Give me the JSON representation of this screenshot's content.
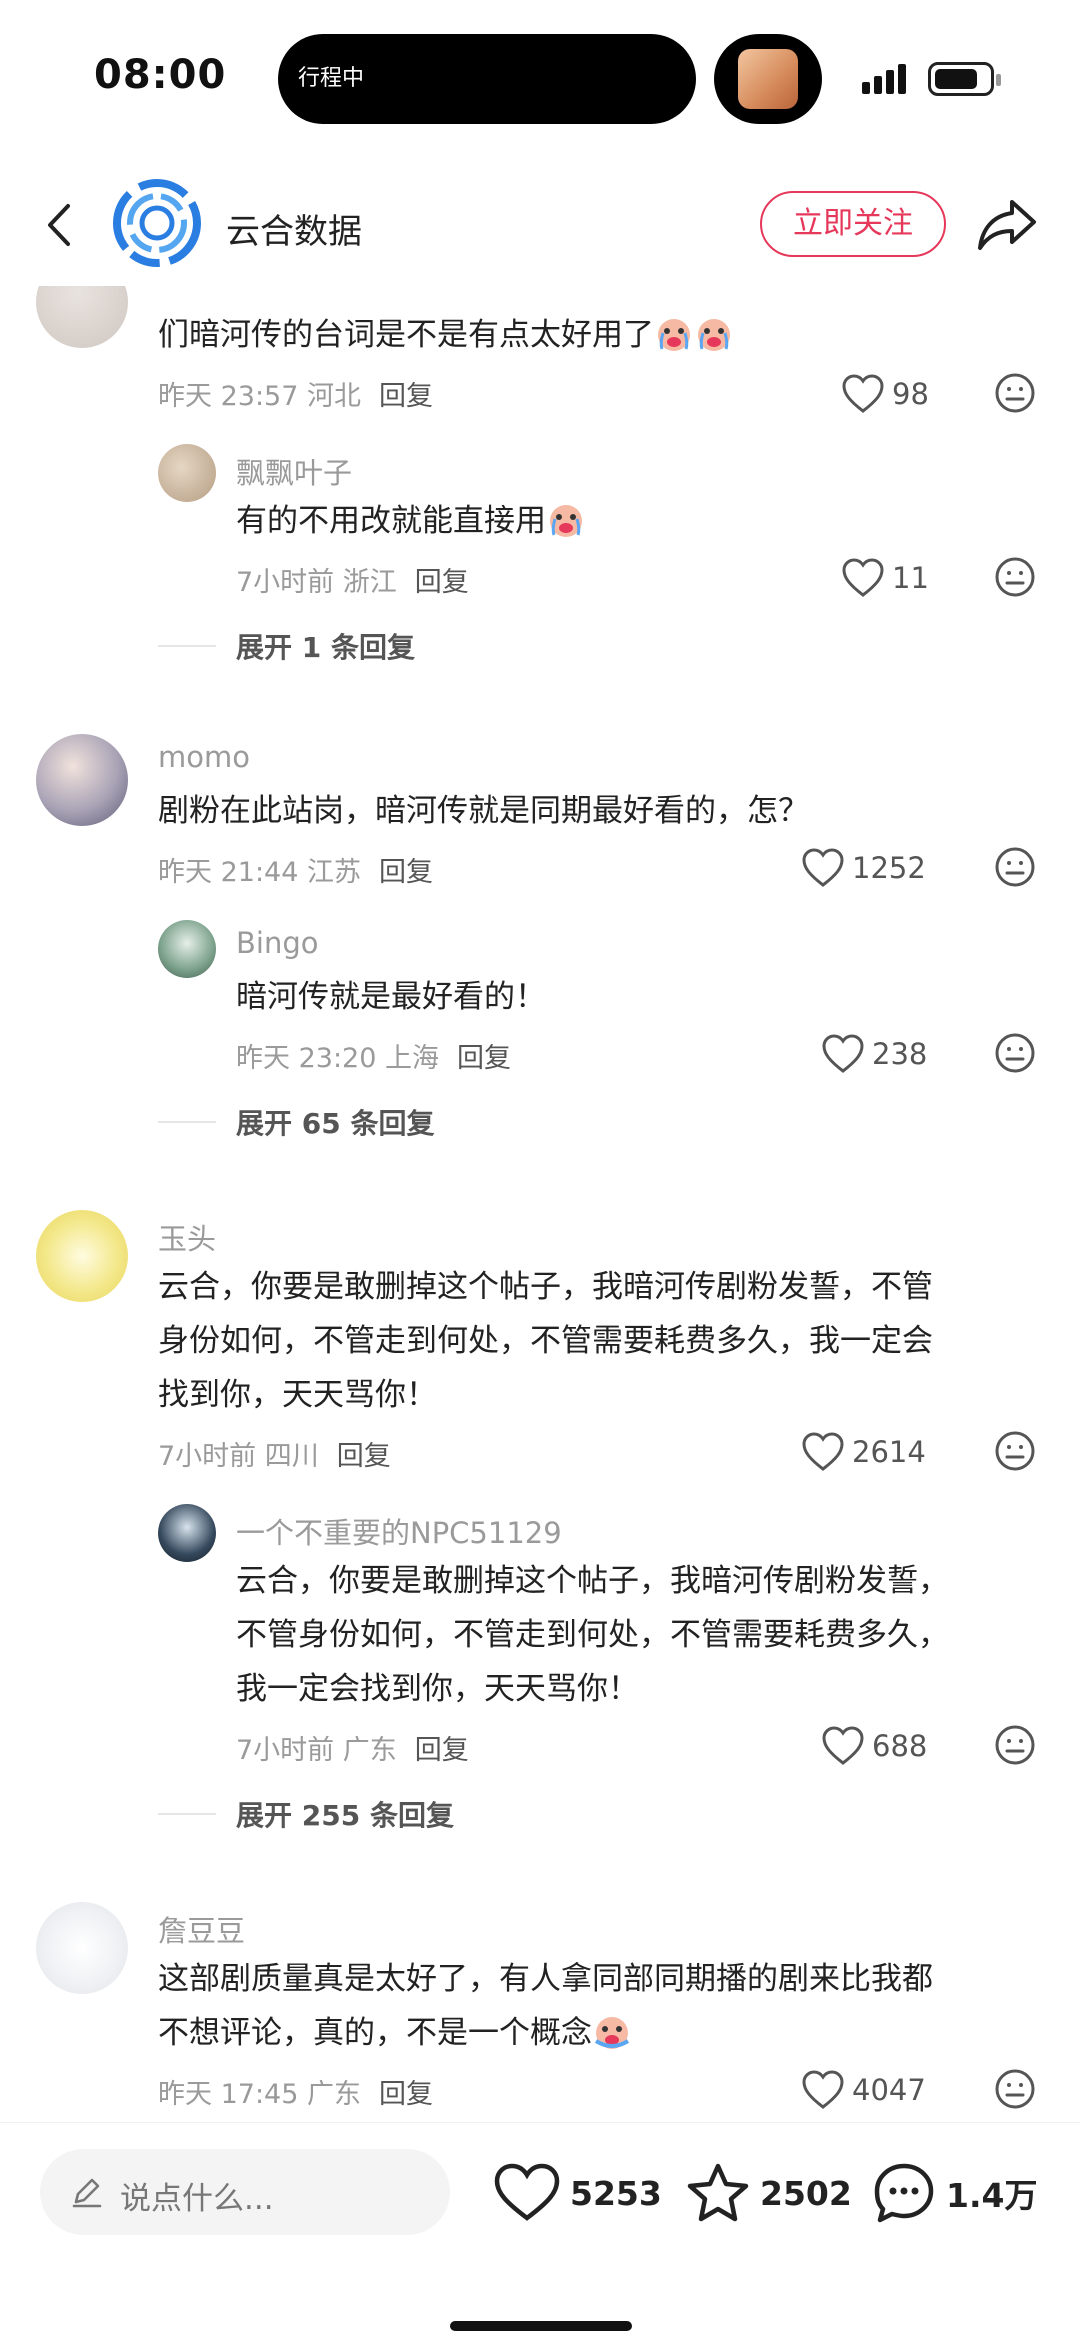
{
  "status_bar": {
    "time": "08:00",
    "island_text": "行程中"
  },
  "nav": {
    "account_name": "云合数据",
    "follow_label": "立即关注"
  },
  "comments": [
    {
      "text": "们暗河传的台词是不是有点太好用了",
      "meta_time": "昨天 23:57",
      "meta_place": "河北",
      "reply_label": "回复",
      "likes": "98",
      "reply": {
        "username": "飘飘叶子",
        "text": "有的不用改就能直接用",
        "meta_time": "7小时前",
        "meta_place": "浙江",
        "reply_label": "回复",
        "likes": "11"
      },
      "expand_label": "展开 1 条回复"
    },
    {
      "username": "momo",
      "text": "剧粉在此站岗，暗河传就是同期最好看的，怎？",
      "meta_time": "昨天 21:44",
      "meta_place": "江苏",
      "reply_label": "回复",
      "likes": "1252",
      "reply": {
        "username": "Bingo",
        "text": "暗河传就是最好看的！",
        "meta_time": "昨天 23:20",
        "meta_place": "上海",
        "reply_label": "回复",
        "likes": "238"
      },
      "expand_label": "展开 65 条回复"
    },
    {
      "username": "玉头",
      "text_lines": [
        "云合，你要是敢删掉这个帖子，我暗河传剧粉发誓，不管",
        "身份如何，不管走到何处，不管需要耗费多久，我一定会",
        "找到你，天天骂你！"
      ],
      "meta_time": "7小时前",
      "meta_place": "四川",
      "reply_label": "回复",
      "likes": "2614",
      "reply": {
        "username": "一个不重要的NPC51129",
        "text_lines": [
          "云合，你要是敢删掉这个帖子，我暗河传剧粉发誓，",
          "不管身份如何，不管走到何处，不管需要耗费多久，",
          "我一定会找到你，天天骂你！"
        ],
        "meta_time": "7小时前",
        "meta_place": "广东",
        "reply_label": "回复",
        "likes": "688"
      },
      "expand_label": "展开 255 条回复"
    },
    {
      "username": "詹豆豆",
      "text_lines": [
        "这部剧质量真是太好了，有人拿同部同期播的剧来比我都",
        "不想评论，真的，不是一个概念"
      ],
      "meta_time": "昨天 17:45",
      "meta_place": "广东",
      "reply_label": "回复",
      "likes": "4047"
    }
  ],
  "bottom_bar": {
    "input_placeholder": "说点什么...",
    "likes": "5253",
    "favorites": "2502",
    "comments": "1.4万"
  },
  "colors": {
    "accent": "#e6385a",
    "muted_text": "#9a9a9a",
    "body_text": "#222222"
  }
}
